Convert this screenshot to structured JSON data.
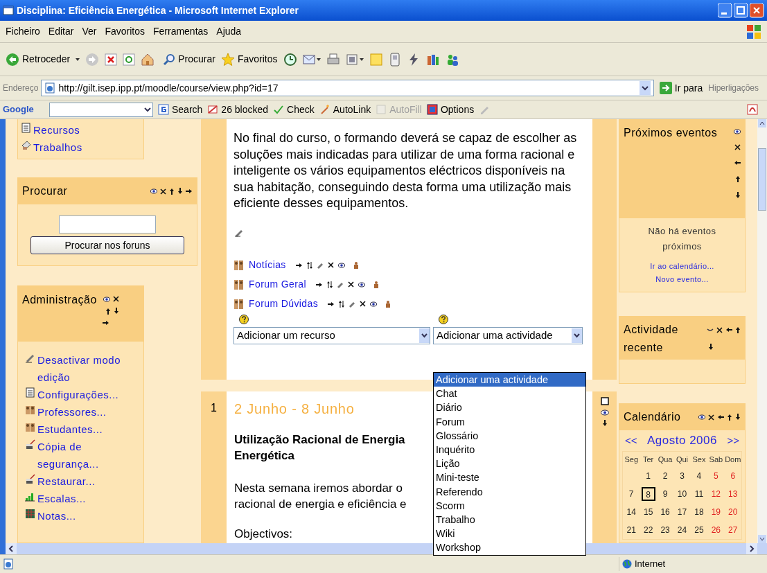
{
  "window": {
    "title": "Disciplina: Eficiência Energética - Microsoft Internet Explorer"
  },
  "menu": [
    "Ficheiro",
    "Editar",
    "Ver",
    "Favoritos",
    "Ferramentas",
    "Ajuda"
  ],
  "toolbar": {
    "back": "Retroceder",
    "search": "Procurar",
    "favorites": "Favoritos"
  },
  "address": {
    "label": "Endereço",
    "url": "http://gilt.isep.ipp.pt/moodle/course/view.php?id=17",
    "go": "Ir para",
    "links": "Hiperligações"
  },
  "google_bar": {
    "logo": "Google",
    "buttons": [
      {
        "kind": "search",
        "label": "Search",
        "disabled": false
      },
      {
        "kind": "blocked",
        "label": "26 blocked",
        "disabled": false
      },
      {
        "kind": "check",
        "label": "Check",
        "disabled": false
      },
      {
        "kind": "autolink",
        "label": "AutoLink",
        "disabled": false
      },
      {
        "kind": "autofill",
        "label": "AutoFill",
        "disabled": true
      },
      {
        "kind": "options",
        "label": "Options",
        "disabled": false
      }
    ]
  },
  "left_blocks": [
    {
      "kind": "links",
      "items": [
        {
          "kind": "resource",
          "label": "Recursos"
        },
        {
          "kind": "assignment",
          "label": "Trabalhos"
        }
      ]
    },
    {
      "kind": "search",
      "title": "Procurar",
      "button": "Procurar nos foruns"
    },
    {
      "kind": "admin",
      "title": "Administração",
      "items": [
        {
          "kind": "edit",
          "label": "Desactivar modo edição"
        },
        {
          "kind": "settings",
          "label": "Configurações..."
        },
        {
          "kind": "people",
          "label": "Professores..."
        },
        {
          "kind": "people",
          "label": "Estudantes..."
        },
        {
          "kind": "backup",
          "label": "Cópia de segurança..."
        },
        {
          "kind": "restore",
          "label": "Restaurar..."
        },
        {
          "kind": "scales",
          "label": "Escalas..."
        },
        {
          "kind": "grades",
          "label": "Notas..."
        }
      ]
    }
  ],
  "summary": {
    "text": "No final do curso, o formando deverá se capaz de escolher as soluções mais indicadas para utilizar de uma forma racional e inteligente os vários equipamentos eléctricos disponíveis na sua habitação, conseguindo desta forma uma utilização mais eficiente desses equipamentos.",
    "modules": [
      {
        "name": "Notícias"
      },
      {
        "name": "Forum Geral"
      },
      {
        "name": "Forum Dúvidas"
      }
    ],
    "add_resource": "Adicionar um recurso",
    "add_activity": "Adicionar uma actividade"
  },
  "activity_dropdown": [
    {
      "label": "Adicionar uma actividade",
      "selected": true
    },
    {
      "label": "Chat",
      "selected": false
    },
    {
      "label": "Diário",
      "selected": false
    },
    {
      "label": "Forum",
      "selected": false
    },
    {
      "label": "Glossário",
      "selected": false
    },
    {
      "label": "Inquérito",
      "selected": false
    },
    {
      "label": "Lição",
      "selected": false
    },
    {
      "label": "Mini-teste",
      "selected": false
    },
    {
      "label": "Referendo",
      "selected": false
    },
    {
      "label": "Scorm",
      "selected": false
    },
    {
      "label": "Trabalho",
      "selected": false
    },
    {
      "label": "Wiki",
      "selected": false
    },
    {
      "label": "Workshop",
      "selected": false
    }
  ],
  "section": {
    "number": "1",
    "dates": "2 Junho - 8 Junho",
    "heading_lines": [
      "Utilização Racional de Energia",
      "Energética"
    ],
    "text_lines": [
      "Nesta semana iremos abordar o",
      "racional de energia e eficiência e"
    ],
    "objectives": "Objectivos:"
  },
  "right_blocks": [
    {
      "kind": "events",
      "title": "Próximos eventos",
      "empty": "Não há eventos próximos",
      "links": [
        "Ir ao calendário...",
        "Novo evento..."
      ]
    },
    {
      "kind": "recent",
      "title": "Actividade recente"
    },
    {
      "kind": "calendar",
      "title": "Calendário",
      "prev": "<<",
      "month": "Agosto 2006",
      "next": ">>",
      "weekdays": [
        "Seg",
        "Ter",
        "Qua",
        "Qui",
        "Sex",
        "Sab",
        "Dom"
      ],
      "weeks": [
        [
          {
            "day": "1",
            "weekend": false,
            "today": false
          },
          {
            "day": "2",
            "weekend": false,
            "today": false
          },
          {
            "day": "3",
            "weekend": false,
            "today": false
          },
          {
            "day": "4",
            "weekend": false,
            "today": false
          },
          {
            "day": "5",
            "weekend": true,
            "today": false
          },
          {
            "day": "6",
            "weekend": true,
            "today": false
          }
        ],
        [
          {
            "day": "7",
            "weekend": false,
            "today": false
          },
          {
            "day": "8",
            "weekend": false,
            "today": true
          },
          {
            "day": "9",
            "weekend": false,
            "today": false
          },
          {
            "day": "10",
            "weekend": false,
            "today": false
          },
          {
            "day": "11",
            "weekend": false,
            "today": false
          },
          {
            "day": "12",
            "weekend": true,
            "today": false
          },
          {
            "day": "13",
            "weekend": true,
            "today": false
          }
        ],
        [
          {
            "day": "14",
            "weekend": false,
            "today": false
          },
          {
            "day": "15",
            "weekend": false,
            "today": false
          },
          {
            "day": "16",
            "weekend": false,
            "today": false
          },
          {
            "day": "17",
            "weekend": false,
            "today": false
          },
          {
            "day": "18",
            "weekend": false,
            "today": false
          },
          {
            "day": "19",
            "weekend": true,
            "today": false
          },
          {
            "day": "20",
            "weekend": true,
            "today": false
          }
        ],
        [
          {
            "day": "21",
            "weekend": false,
            "today": false
          },
          {
            "day": "22",
            "weekend": false,
            "today": false
          },
          {
            "day": "23",
            "weekend": false,
            "today": false
          },
          {
            "day": "24",
            "weekend": false,
            "today": false
          },
          {
            "day": "25",
            "weekend": false,
            "today": false
          },
          {
            "day": "26",
            "weekend": true,
            "today": false
          },
          {
            "day": "27",
            "weekend": true,
            "today": false
          }
        ]
      ]
    }
  ],
  "status_bar": {
    "zone": "Internet"
  }
}
